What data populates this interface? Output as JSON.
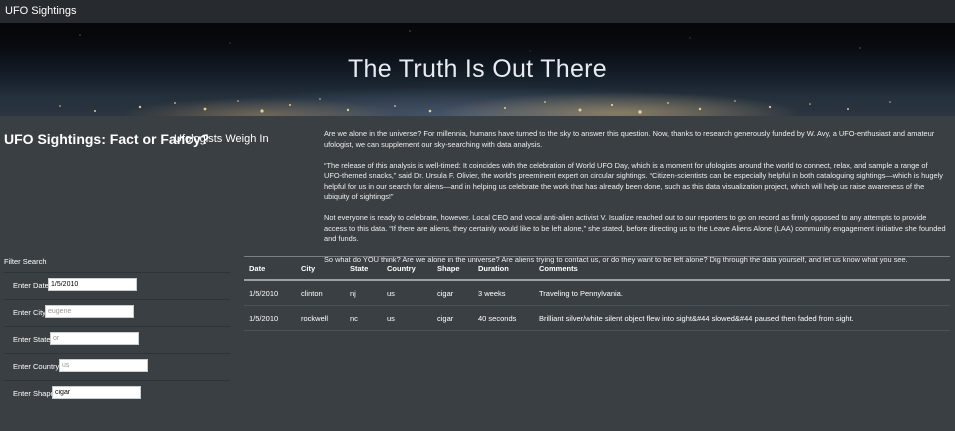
{
  "navbar": {
    "brand": "UFO Sightings"
  },
  "hero": {
    "title": "The Truth Is Out There"
  },
  "heading": {
    "main": "UFO Sightings: Fact or Fancy?",
    "sub": "Ufologists Weigh In"
  },
  "article": {
    "paragraphs": [
      "Are we alone in the universe? For millennia, humans have turned to the sky to answer this question. Now, thanks to research generously funded by W. Avy, a UFO-enthusiast and amateur ufologist, we can supplement our sky-searching with data analysis.",
      "“The release of this analysis is well-timed: It coincides with the celebration of World UFO Day, which is a moment for ufologists around the world to connect, relax, and sample a range of UFO-themed snacks,” said Dr. Ursula F. Olivier, the world’s preeminent expert on circular sightings. “Citizen-scientists can be especially helpful in both cataloguing sightings—which is hugely helpful for us in our search for aliens—and in helping us celebrate the work that has already been done, such as this data visualization project, which will help us raise awareness of the ubiquity of sightings!”",
      "Not everyone is ready to celebrate, however. Local CEO and vocal anti-alien activist V. Isualize reached out to our reporters to go on record as firmly opposed to any attempts to provide access to this data. “If there are aliens, they certainly would like to be left alone,” she stated, before directing us to the Leave Aliens Alone (LAA) community engagement initiative she founded and funds.",
      "So what do YOU think? Are we alone in the universe? Are aliens trying to contact us, or do they want to be left alone? Dig through the data yourself, and let us know what you see."
    ]
  },
  "filters": {
    "title": "Filter Search",
    "items": [
      {
        "label": "Enter Date",
        "value": "1/5/2010",
        "placeholder": ""
      },
      {
        "label": "Enter City",
        "value": "",
        "placeholder": "eugene"
      },
      {
        "label": "Enter State",
        "value": "",
        "placeholder": "or"
      },
      {
        "label": "Enter Country",
        "value": "",
        "placeholder": "us"
      },
      {
        "label": "Enter Shape",
        "value": "cigar",
        "placeholder": ""
      }
    ]
  },
  "table": {
    "headers": [
      "Date",
      "City",
      "State",
      "Country",
      "Shape",
      "Duration",
      "Comments"
    ],
    "rows": [
      [
        "1/5/2010",
        "clinton",
        "nj",
        "us",
        "cigar",
        "3 weeks",
        "Traveling to Pennylvania."
      ],
      [
        "1/5/2010",
        "rockwell",
        "nc",
        "us",
        "cigar",
        "40 seconds",
        "Brilliant silver/white silent object flew into sight&#44 slowed&#44 paused then faded from sight."
      ]
    ]
  }
}
